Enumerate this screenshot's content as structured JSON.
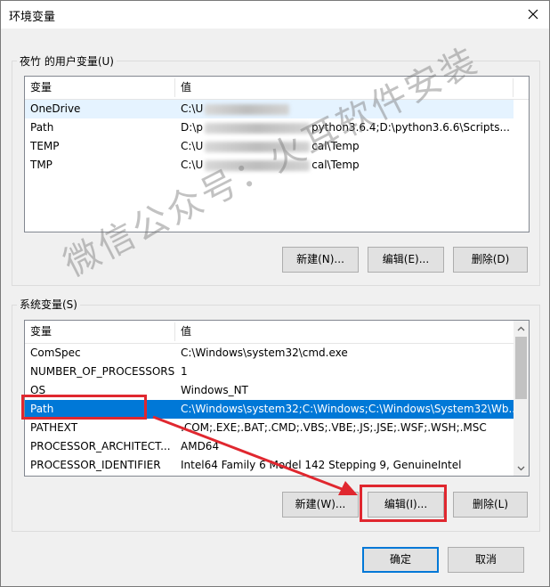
{
  "window": {
    "title": "环境变量"
  },
  "user_vars": {
    "group_label": "夜竹 的用户变量(U)",
    "headers": [
      "变量",
      "值"
    ],
    "rows": [
      {
        "name": "OneDrive",
        "value": "C:\\U"
      },
      {
        "name": "Path",
        "value": "D:\\p",
        "value_tail": "python3.6.4;D:\\python3.6.6\\Scripts..."
      },
      {
        "name": "TEMP",
        "value": "C:\\U",
        "value_tail": "cal\\Temp"
      },
      {
        "name": "TMP",
        "value": "C:\\U",
        "value_tail": "cal\\Temp"
      }
    ],
    "buttons": {
      "new": "新建(N)...",
      "edit": "编辑(E)...",
      "delete": "删除(D)"
    }
  },
  "system_vars": {
    "group_label": "系统变量(S)",
    "headers": [
      "变量",
      "值"
    ],
    "rows": [
      {
        "name": "ComSpec",
        "value": "C:\\Windows\\system32\\cmd.exe"
      },
      {
        "name": "NUMBER_OF_PROCESSORS",
        "value": "1"
      },
      {
        "name": "OS",
        "value": "Windows_NT"
      },
      {
        "name": "Path",
        "value": "C:\\Windows\\system32;C:\\Windows;C:\\Windows\\System32\\Wb..."
      },
      {
        "name": "PATHEXT",
        "value": ".COM;.EXE;.BAT;.CMD;.VBS;.VBE;.JS;.JSE;.WSF;.WSH;.MSC"
      },
      {
        "name": "PROCESSOR_ARCHITECT...",
        "value": "AMD64"
      },
      {
        "name": "PROCESSOR_IDENTIFIER",
        "value": "Intel64 Family 6 Model 142 Stepping 9, GenuineIntel"
      }
    ],
    "selected_row": "Path",
    "buttons": {
      "new": "新建(W)...",
      "edit": "编辑(I)...",
      "delete": "删除(L)"
    }
  },
  "footer": {
    "ok": "确定",
    "cancel": "取消"
  },
  "watermark": "微信公众号：火耳软件安装",
  "colors": {
    "selection": "#0078d7",
    "annotation": "#e0272f"
  },
  "icons": [
    "close-icon",
    "scroll-up-icon",
    "scroll-down-icon",
    "annotation-arrow"
  ]
}
